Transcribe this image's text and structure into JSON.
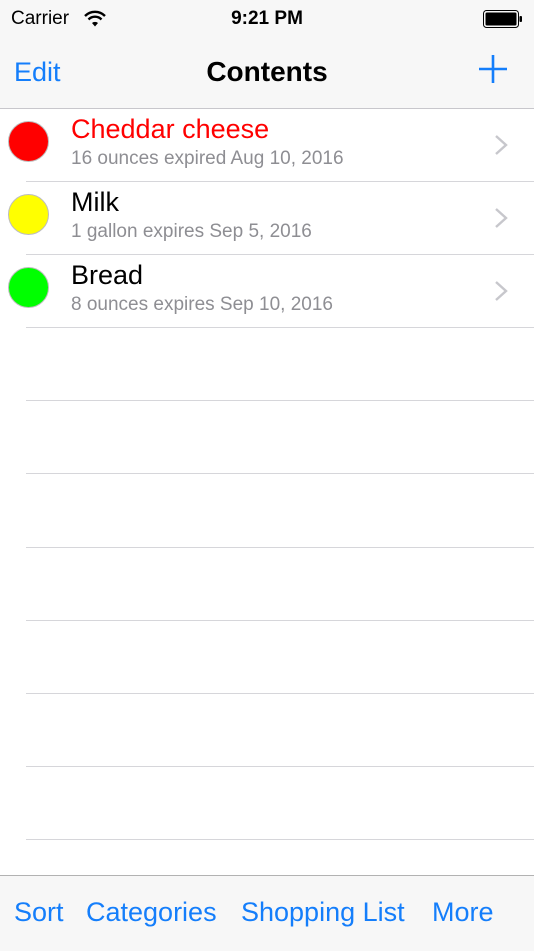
{
  "status": {
    "carrier": "Carrier",
    "time": "9:21 PM"
  },
  "nav": {
    "edit_label": "Edit",
    "title": "Contents",
    "add_icon": "plus-icon"
  },
  "items": [
    {
      "name": "Cheddar cheese",
      "detail": "16 ounces expired Aug 10, 2016",
      "status_color": "#ff0000",
      "name_color": "#ff0000"
    },
    {
      "name": "Milk",
      "detail": "1 gallon expires Sep 5, 2016",
      "status_color": "#ffff00",
      "name_color": "#000000"
    },
    {
      "name": "Bread",
      "detail": "8 ounces expires Sep 10, 2016",
      "status_color": "#00ff00",
      "name_color": "#000000"
    }
  ],
  "toolbar": {
    "sort_label": "Sort",
    "categories_label": "Categories",
    "shopping_list_label": "Shopping List",
    "more_label": "More"
  },
  "colors": {
    "accent": "#147efb",
    "secondary_text": "#8e8e93"
  }
}
